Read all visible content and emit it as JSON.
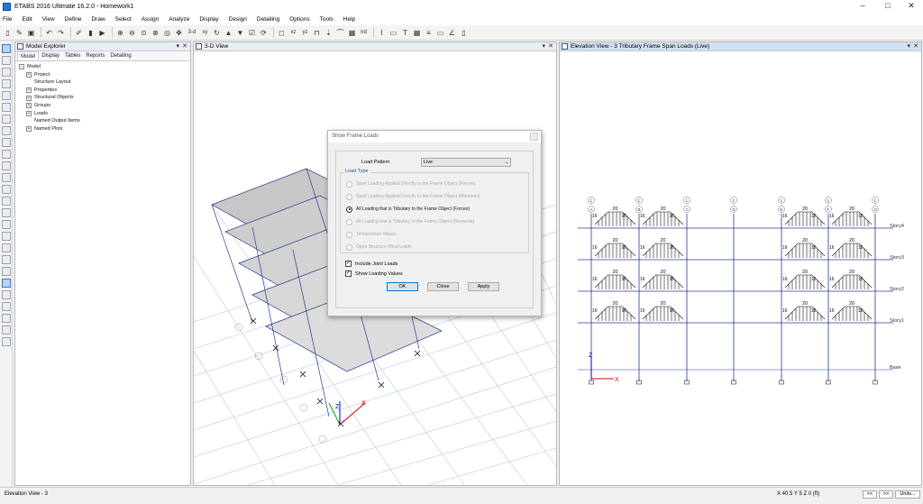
{
  "window": {
    "title": "ETABS 2016 Ultimate 16.2.0 - Homework1",
    "controls": {
      "minimize": "–",
      "maximize": "□",
      "close": "✕"
    }
  },
  "menu": [
    "File",
    "Edit",
    "View",
    "Define",
    "Draw",
    "Select",
    "Assign",
    "Analyze",
    "Display",
    "Design",
    "Detailing",
    "Options",
    "Tools",
    "Help"
  ],
  "toolbar_icons": [
    "new-icon",
    "pencil-icon",
    "save-icon",
    "undo-icon",
    "redo-icon",
    "edit-icon",
    "lock-icon",
    "run-icon",
    "zoom-in-icon",
    "zoom-out-icon",
    "zoom-window-icon",
    "zoom-prev-icon",
    "zoom-all-icon",
    "pan-icon",
    "3d-view-icon",
    "plan-view-icon",
    "elevation-view-icon",
    "rotate-icon",
    "up-icon",
    "down-icon",
    "view-options-icon",
    "refresh-icon",
    "object-shrink-icon",
    "extrude-icon",
    "display-undeformed-icon",
    "display-loads-icon",
    "display-deformed-icon",
    "display-forces-icon",
    "display-design-icon"
  ],
  "toolbar_text": {
    "t1": "3-d",
    "t2": "xy",
    "t3": "xz",
    "t4": "yz",
    "t5": "nd"
  },
  "model_explorer": {
    "title": "Model Explorer",
    "pin": "▾",
    "close": "✕",
    "tabs": [
      "Model",
      "Display",
      "Tables",
      "Reports",
      "Detailing"
    ],
    "tree": {
      "root": "Model",
      "children": [
        "Project",
        "Structure Layout",
        "Properties",
        "Structural Objects",
        "Groups",
        "Loads",
        "Named Output Items",
        "Named Plots"
      ]
    }
  },
  "view3d": {
    "title": "3-D View",
    "pin": "▾",
    "close": "✕"
  },
  "elevation": {
    "title": "Elevation View - 3  Tributary Frame Span Loads  (Live)",
    "pin": "▾",
    "close": "✕",
    "stories": [
      "Story4",
      "Story3",
      "Story2",
      "Story1",
      "Base"
    ],
    "grid_bubbles": [
      {
        "top": "1",
        "bottom": "A"
      },
      {
        "top": "1",
        "bottom": "B"
      },
      {
        "top": "1",
        "bottom": "C"
      },
      {
        "top": "1",
        "bottom": "D"
      },
      {
        "top": "1",
        "bottom": "E"
      },
      {
        "top": "1",
        "bottom": "F"
      },
      {
        "top": "1",
        "bottom": "G"
      }
    ],
    "load_value_top": "20",
    "load_value_side": "16",
    "axis_z": "Z",
    "axis_x": "X"
  },
  "dialog": {
    "title": "Show Frame Loads",
    "load_pattern_label": "Load Pattern",
    "load_pattern_value": "Live",
    "load_type_label": "Load Type",
    "options": [
      {
        "label": "Span Loading Applied Directly to the Frame Object (Forces)",
        "selected": false,
        "enabled": false
      },
      {
        "label": "Span Loading Applied Directly to the Frame Object (Moments)",
        "selected": false,
        "enabled": false
      },
      {
        "label": "All Loading that is Tributary to the Frame Object (Forces)",
        "selected": true,
        "enabled": true
      },
      {
        "label": "All Loading that is Tributary to the Frame Object (Moments)",
        "selected": false,
        "enabled": false
      },
      {
        "label": "Temperature Values",
        "selected": false,
        "enabled": false
      },
      {
        "label": "Open Structure Wind Loads",
        "selected": false,
        "enabled": false
      }
    ],
    "checkboxes": [
      {
        "label": "Include Joint Loads",
        "checked": true
      },
      {
        "label": "Show Loading Values",
        "checked": true
      }
    ],
    "buttons": {
      "ok": "OK",
      "close": "Close",
      "apply": "Apply"
    },
    "check_mark": "✓"
  },
  "status": {
    "left": "Elevation View - 3",
    "coords": "X 40.5  Y 5  Z 0 (ft)",
    "prev": "<<",
    "next": ">>",
    "units": "Units..."
  },
  "colors": {
    "accent": "#0078d7",
    "slab": "#c9c9c9",
    "frame": "#2b3a8f",
    "load_arrow": "#111111",
    "grid_3d": "#b7c9e6"
  }
}
